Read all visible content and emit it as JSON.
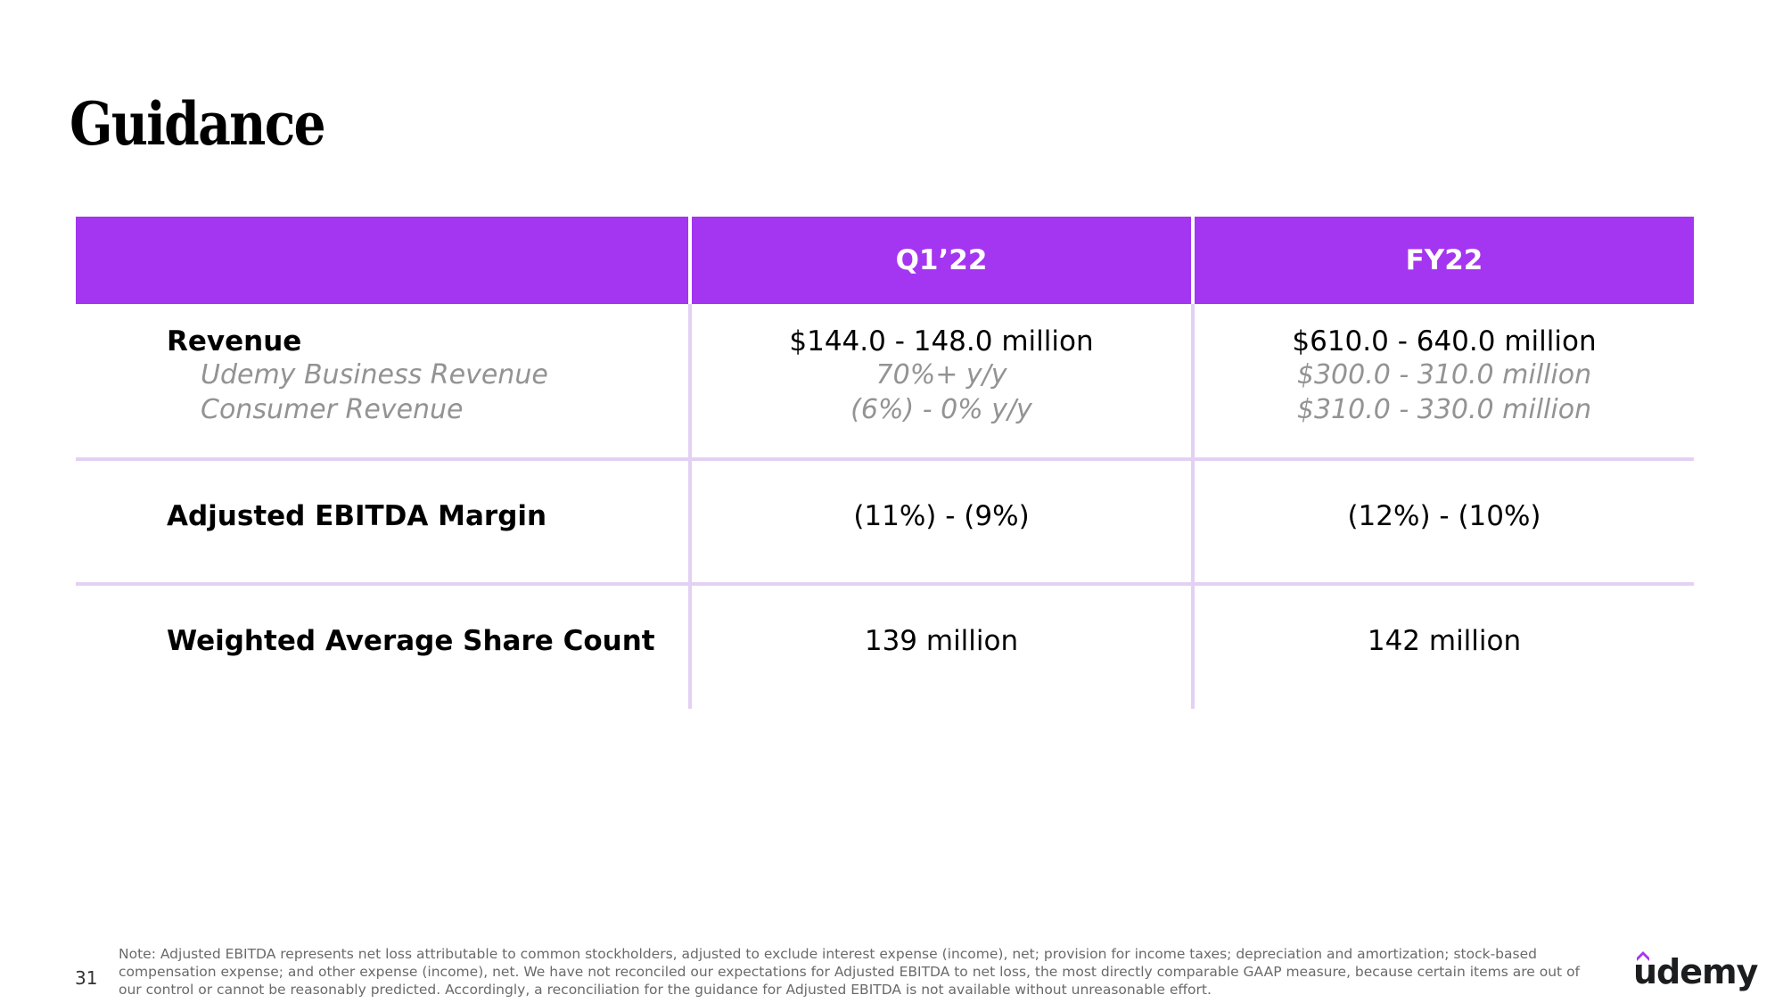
{
  "slide": {
    "title": "Guidance",
    "page_number": "31",
    "note": "Note: Adjusted EBITDA represents net loss attributable to common stockholders, adjusted to exclude interest expense (income), net; provision for income taxes; depreciation and amortization; stock-based compensation expense; and other expense (income), net. We have not reconciled our expectations for Adjusted EBITDA to net loss, the most directly comparable GAAP measure, because certain items are out of our control or cannot be reasonably predicted. Accordingly, a reconciliation for the guidance for Adjusted EBITDA is not available without unreasonable effort.",
    "logo_text": "udemy",
    "accent_color": "#a435f0",
    "divider_color": "#e3d1f4"
  },
  "table": {
    "headers": [
      "",
      "Q1’22",
      "FY22"
    ],
    "rows": [
      {
        "label": "Revenue",
        "sublabels": [
          "Udemy Business Revenue",
          "Consumer Revenue"
        ],
        "q1": "$144.0 - 148.0 million",
        "q1_sub": [
          "70%+ y/y",
          "(6%) - 0% y/y"
        ],
        "fy": "$610.0 - 640.0 million",
        "fy_sub": [
          "$300.0 - 310.0 million",
          "$310.0 - 330.0 million"
        ]
      },
      {
        "label": "Adjusted EBITDA Margin",
        "q1": "(11%) - (9%)",
        "fy": "(12%) - (10%)"
      },
      {
        "label": "Weighted Average Share Count",
        "q1": "139 million",
        "fy": "142 million"
      }
    ]
  }
}
